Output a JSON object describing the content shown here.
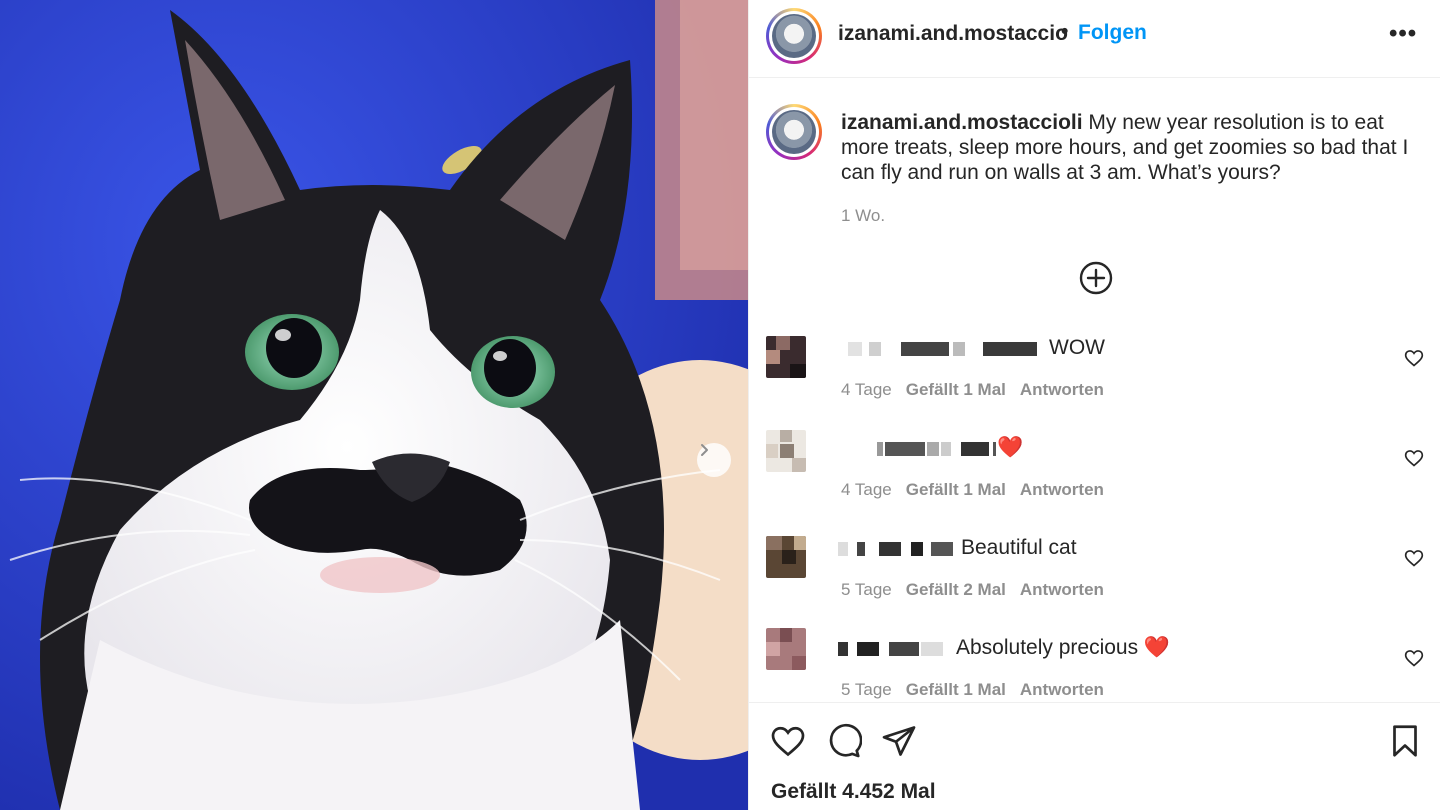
{
  "post": {
    "image_alt": "Black and white cat with mustache-like nose marking",
    "next_arrow": "chevron-right-icon"
  },
  "header": {
    "username": "izanami.and.mostaccio",
    "separator": "•",
    "follow_label": "Folgen",
    "more_label": "•••"
  },
  "caption": {
    "username": "izanami.and.mostaccioli",
    "text": "My new year resolution is to eat more treats, sleep more hours, and get zoomies so bad that I can fly and run on walls at 3 am. What’s yours?",
    "time": "1 Wo."
  },
  "comments": [
    {
      "text": "WOW",
      "time": "4 Tage",
      "likes": "Gefällt 1 Mal",
      "reply": "Antworten"
    },
    {
      "text": "❤️",
      "time": "4 Tage",
      "likes": "Gefällt 1 Mal",
      "reply": "Antworten"
    },
    {
      "text": "Beautiful cat",
      "time": "5 Tage",
      "likes": "Gefällt 2 Mal",
      "reply": "Antworten"
    },
    {
      "text": "Absolutely precious ❤️",
      "time": "5 Tage",
      "likes": "Gefällt 1 Mal",
      "reply": "Antworten"
    }
  ],
  "footer": {
    "likes_label": "Gefällt 4.452 Mal"
  },
  "colors": {
    "accent": "#0095f6",
    "text": "#262626",
    "muted": "#8e8e8e",
    "heart": "#ed4956"
  }
}
